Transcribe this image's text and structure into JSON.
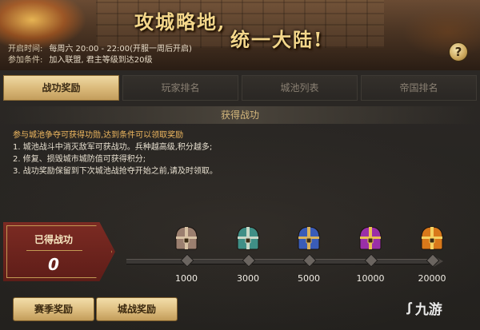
{
  "banner": {
    "title_line1": "攻城略地,",
    "title_line2": "统一大陆!",
    "open_time_label": "开启时间:",
    "open_time_value": "每周六 20:00 - 22:00(开服一周后开启)",
    "condition_label": "参加条件:",
    "condition_value": "加入联盟, 君主等级到达20级",
    "help_icon": "question-icon",
    "help_glyph": "?"
  },
  "tabs": [
    {
      "label": "战功奖励",
      "active": true
    },
    {
      "label": "玩家排名",
      "active": false
    },
    {
      "label": "城池列表",
      "active": false
    },
    {
      "label": "帝国排名",
      "active": false
    }
  ],
  "section": {
    "title": "获得战功",
    "lines": [
      "参与城池争夺可获得功勋,达到条件可以领取奖励",
      "1. 城池战斗中消灭敌军可获战功。兵种越高级,积分越多;",
      "2. 修复、损毁城市城防值可获得积分;",
      "3. 战功奖励保留到下次城池战抢夺开始之前,请及时领取。"
    ]
  },
  "earned": {
    "label": "已得战功",
    "value": "0"
  },
  "milestones": [
    {
      "value": "1000",
      "chest_color": "#9b7f6f",
      "trim": "#d8c2a4",
      "icon": "chest-icon"
    },
    {
      "value": "3000",
      "chest_color": "#3f8f86",
      "trim": "#c8d8c8",
      "icon": "chest-icon"
    },
    {
      "value": "5000",
      "chest_color": "#3a5cb8",
      "trim": "#d9b25a",
      "icon": "chest-icon"
    },
    {
      "value": "10000",
      "chest_color": "#9a2fa8",
      "trim": "#e8c050",
      "icon": "chest-icon"
    },
    {
      "value": "20000",
      "chest_color": "#d8781a",
      "trim": "#f4d060",
      "icon": "chest-icon"
    }
  ],
  "buttons": {
    "season_reward": "赛季奖励",
    "battle_reward": "城战奖励"
  },
  "watermark": {
    "brand": "九游"
  }
}
